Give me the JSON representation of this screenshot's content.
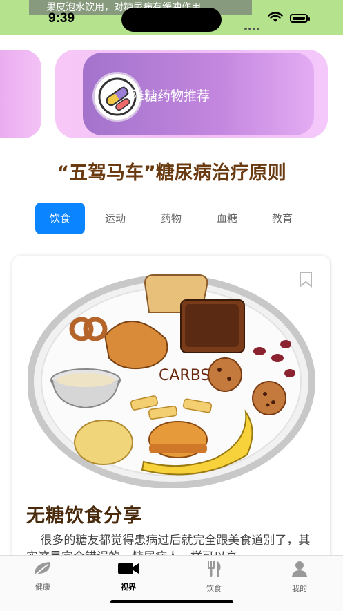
{
  "status_bar": {
    "marquee": "果皮泡水饮用，对糖尿病有缓冲作用。",
    "time": "9:39"
  },
  "banner": {
    "text": "降糖药物推荐",
    "icon": "pill-icon"
  },
  "page_title": "“五驾马车”糖尿病治疗原则",
  "tabs": [
    {
      "label": "饮食",
      "active": true
    },
    {
      "label": "运动",
      "active": false
    },
    {
      "label": "药物",
      "active": false
    },
    {
      "label": "血糖",
      "active": false
    },
    {
      "label": "教育",
      "active": false
    }
  ],
  "card": {
    "image_label": "CARBS",
    "title": "无糖饮食分享",
    "body": "很多的糖友都觉得患病过后就完全跟美食道别了，其实这是完全错误的，糖尿病人一样可以享"
  },
  "tabbar": [
    {
      "label": "健康",
      "icon": "leaf-icon",
      "active": false
    },
    {
      "label": "视界",
      "icon": "video-camera-icon",
      "active": true
    },
    {
      "label": "饮食",
      "icon": "fork-knife-icon",
      "active": false
    },
    {
      "label": "我的",
      "icon": "person-icon",
      "active": false
    }
  ],
  "colors": {
    "status_bg": "#b4e28d",
    "tab_active": "#0a84ff",
    "title_brown": "#6a3a10"
  }
}
